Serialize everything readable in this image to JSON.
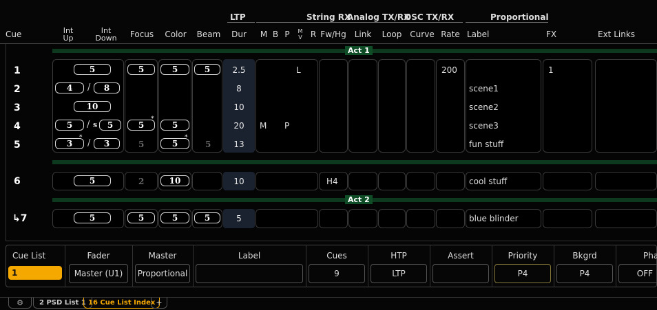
{
  "group_headers": {
    "ltp": "LTP",
    "string_rx": "String RX",
    "analog": "Analog TX/RX",
    "osc": "OSC TX/RX",
    "proportional": "Proportional"
  },
  "columns": {
    "cue": "Cue",
    "int_up": [
      "Int",
      "Up"
    ],
    "int_down": [
      "Int",
      "Down"
    ],
    "focus": "Focus",
    "color": "Color",
    "beam": "Beam",
    "dur": "Dur",
    "m": "M",
    "b": "B",
    "p": "P",
    "mv": [
      "M",
      "V"
    ],
    "r": "R",
    "fwhg": "Fw/Hg",
    "link": "Link",
    "loop": "Loop",
    "curve": "Curve",
    "rate": "Rate",
    "label": "Label",
    "fx": "FX",
    "ext_links": "Ext Links"
  },
  "parts": {
    "act1": "Act 1",
    "act2": "Act 2"
  },
  "cues": [
    {
      "number": "1",
      "int_up": "5",
      "focus": "5",
      "color": "5",
      "beam": "5",
      "dur": "2.5",
      "p": "L",
      "rate": "200",
      "label": "",
      "fx": "1"
    },
    {
      "number": "2",
      "int_up": "4",
      "int_down": "8",
      "dur": "8",
      "label": "scene1"
    },
    {
      "number": "3",
      "int_up": "10",
      "dur": "10",
      "label": "scene2"
    },
    {
      "number": "4",
      "int_up": "5",
      "int_down_prefix": "s",
      "int_down": "5",
      "focus": "5",
      "color": "5",
      "dur": "20",
      "m": "M",
      "p": "P",
      "label": "scene3"
    },
    {
      "number": "5",
      "int_up": "3",
      "int_down": "3",
      "focus": "5",
      "color": "5",
      "beam": "5",
      "dur": "13",
      "label": "fun stuff"
    },
    {
      "number": "6",
      "int_up": "5",
      "focus": "2",
      "color": "10",
      "dur": "10",
      "fwhg": "H4",
      "label": "cool stuff"
    },
    {
      "number": "↳7",
      "int_up": "5",
      "focus": "5",
      "color": "5",
      "beam": "5",
      "dur": "5",
      "label": "blue blinder"
    }
  ],
  "separator": "/",
  "bottom": {
    "headers": {
      "cue_list": "Cue List",
      "fader": "Fader",
      "master": "Master",
      "label": "Label",
      "cues": "Cues",
      "htp": "HTP",
      "assert": "Assert",
      "priority": "Priority",
      "bkgrd": "Bkgrd",
      "phantom": "Phantom"
    },
    "values": {
      "cue_list": "1",
      "fader": "Master (U1)",
      "master": "Proportional",
      "label": "",
      "cues": "9",
      "htp": "LTP",
      "assert": "",
      "priority": "P4",
      "bkgrd": "P4",
      "phantom": "OFF"
    }
  },
  "tabs": [
    {
      "label": "2 PSD List 1"
    },
    {
      "label": "16 Cue List Index"
    },
    {
      "label": "+"
    }
  ],
  "colors": {
    "accent": "#f5a800",
    "part_bar": "#0d3a1f",
    "part_label_bg": "#0f4d26"
  },
  "icons": {
    "settings": "gear-icon"
  }
}
